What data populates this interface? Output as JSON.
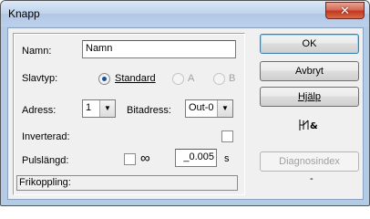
{
  "window": {
    "title": "Knapp",
    "close_glyph": "✕"
  },
  "form": {
    "name_label": "Namn:",
    "name_value": "Namn",
    "slavetype_label": "Slavtyp:",
    "radio_standard": "Standard",
    "radio_a": "A",
    "radio_b": "B",
    "address_label": "Adress:",
    "address_value": "1",
    "bitaddress_label": "Bitadress:",
    "bitaddress_value": "Out-0",
    "inverted_label": "Inverterad:",
    "pulse_label": "Pulslängd:",
    "infinity_glyph": "∞",
    "pulse_value": "_0.005",
    "pulse_unit": "s",
    "status_text": "Frikoppling:"
  },
  "buttons": {
    "ok": "OK",
    "cancel": "Avbryt",
    "help": "Hjälp",
    "diagnostics": "Diagnosindex"
  },
  "side": {
    "contact_icon": "contact-symbol-icon",
    "dash": "-"
  },
  "state": {
    "slavetype_selected": "Standard",
    "inverted_checked": false,
    "infinite_checked": false
  }
}
